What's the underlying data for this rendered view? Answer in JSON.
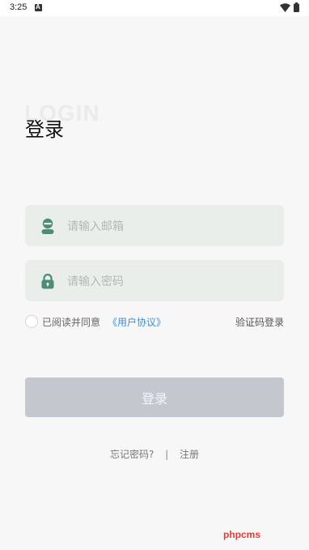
{
  "status_bar": {
    "time": "3:25"
  },
  "header": {
    "watermark": "LOGIN",
    "title": "登录"
  },
  "form": {
    "email_placeholder": "请输入邮箱",
    "password_placeholder": "请输入密码",
    "agree_text": "已阅读并同意",
    "agreement_link": "《用户协议》",
    "sms_login": "验证码登录",
    "login_button": "登录"
  },
  "footer": {
    "forgot_password": "忘记密码?",
    "divider": "|",
    "register": "注册"
  },
  "watermark": {
    "text": "phpcms"
  },
  "colors": {
    "accent": "#4c8c78",
    "link": "#3b8fd6",
    "button_disabled": "#c3c8ce",
    "input_bg": "#e9eeeb"
  },
  "icons": {
    "email_field": "user-icon",
    "password_field": "lock-icon"
  }
}
